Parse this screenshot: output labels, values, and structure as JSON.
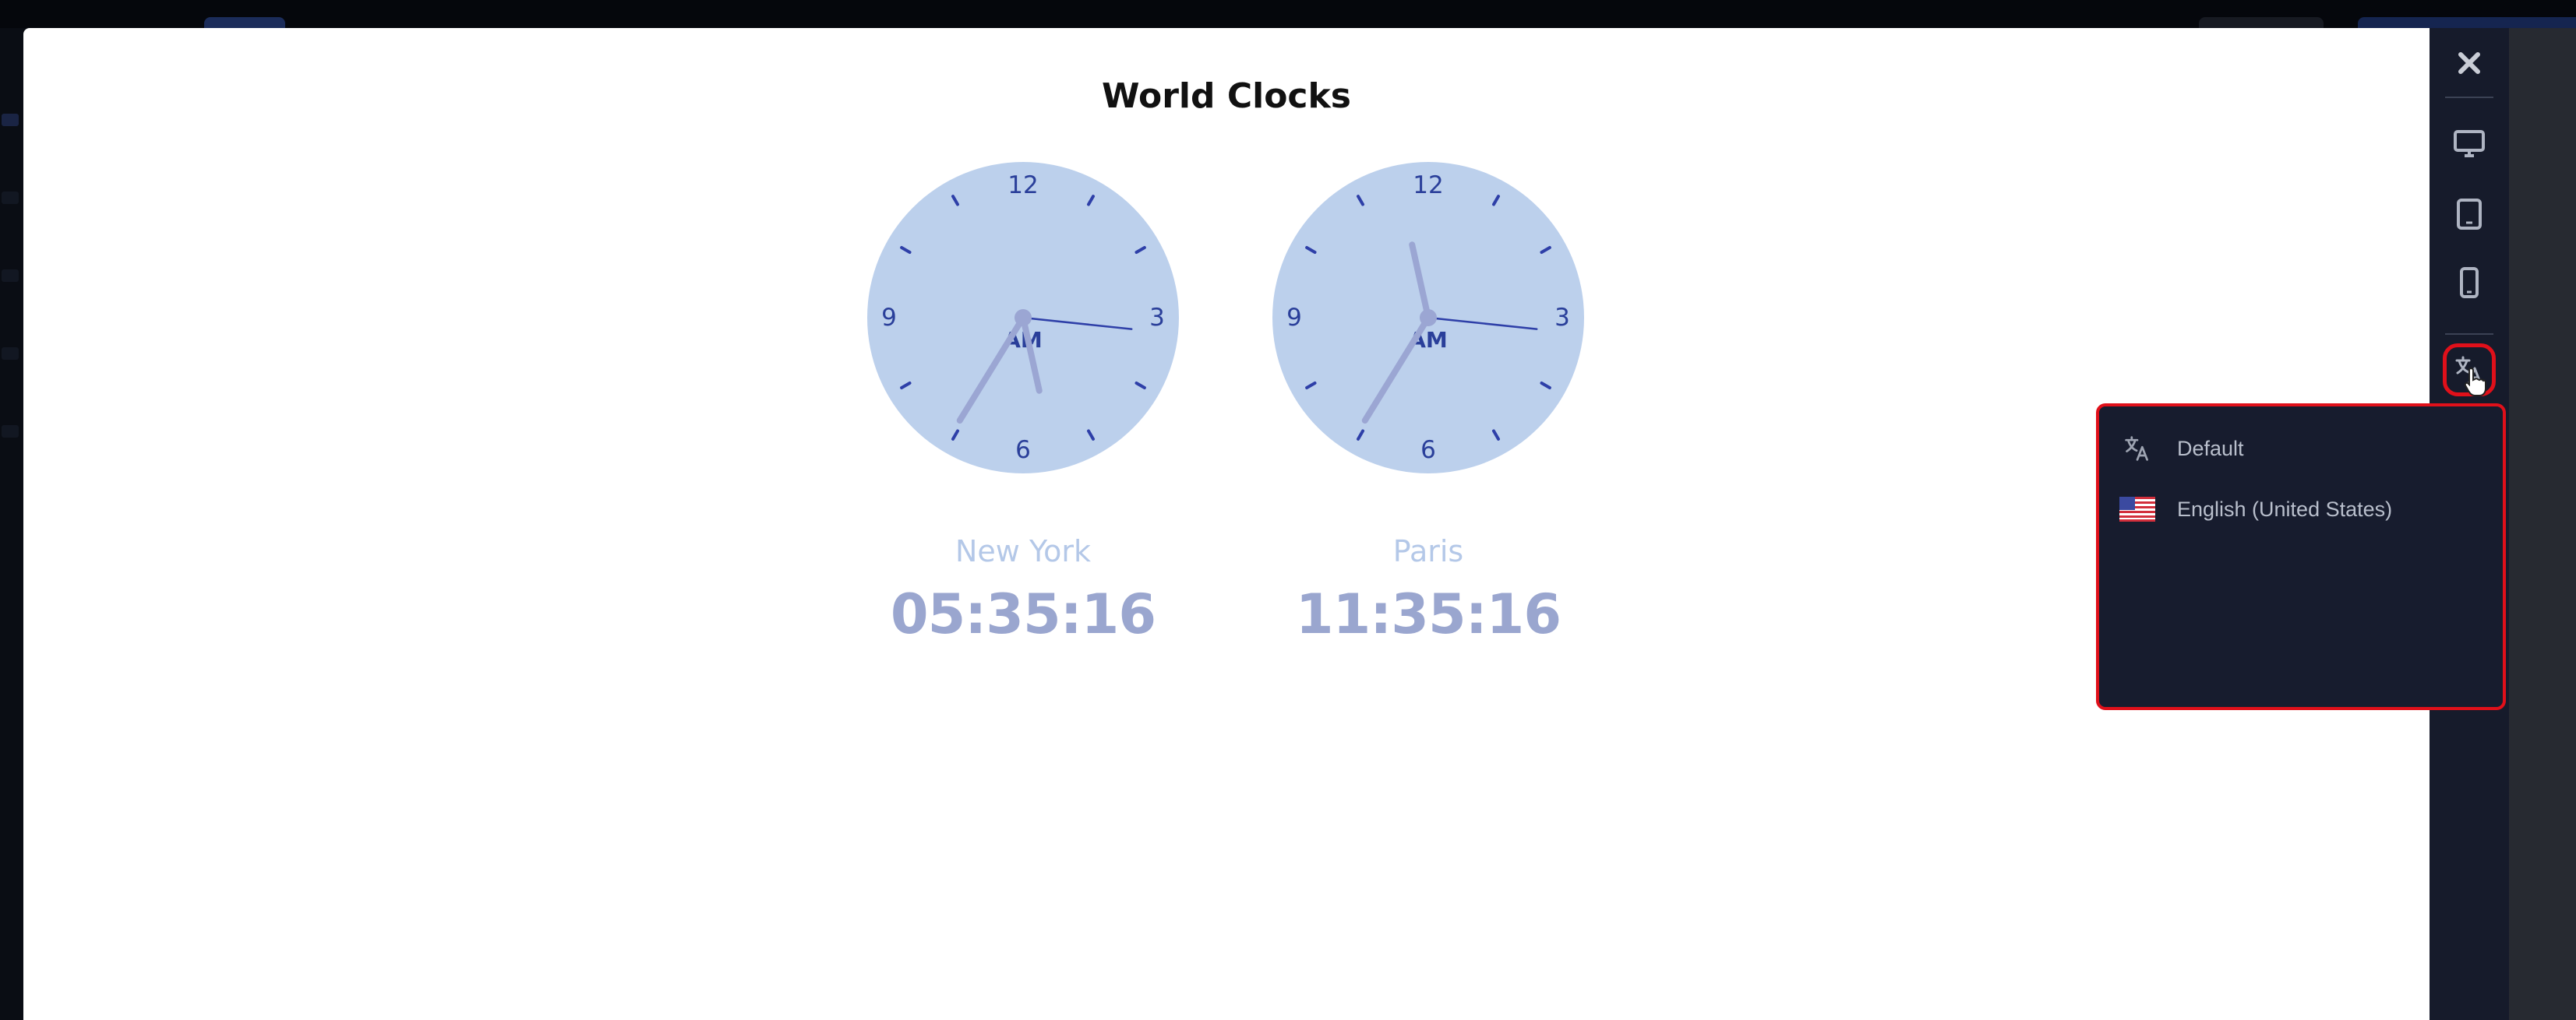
{
  "modal": {
    "title": "World Clocks"
  },
  "clocks": [
    {
      "city": "New York",
      "time": "05:35:16",
      "period": "AM",
      "dial_numbers": [
        "12",
        "3",
        "6",
        "9"
      ],
      "hour": 5,
      "minute": 35,
      "second": 16
    },
    {
      "city": "Paris",
      "time": "11:35:16",
      "period": "AM",
      "dial_numbers": [
        "12",
        "3",
        "6",
        "9"
      ],
      "hour": 11,
      "minute": 35,
      "second": 16
    }
  ],
  "toolbar": {
    "buttons": [
      {
        "name": "close",
        "icon": "close-icon"
      },
      {
        "name": "desktop",
        "icon": "monitor-icon"
      },
      {
        "name": "tablet",
        "icon": "tablet-icon"
      },
      {
        "name": "mobile",
        "icon": "phone-icon"
      },
      {
        "name": "language",
        "icon": "translate-icon",
        "active": true
      }
    ]
  },
  "language_menu": {
    "items": [
      {
        "label": "Default",
        "icon": "translate-icon"
      },
      {
        "label": "English (United States)",
        "icon": "us-flag-icon"
      }
    ]
  },
  "colors": {
    "modal_bg": "#ffffff",
    "toolbar_bg": "#161b2b",
    "dropdown_bg": "#171c2e",
    "highlight": "#e0101a",
    "clock_face": "#bcd0ec",
    "clock_hand": "#9ba6d3",
    "second_hand": "#2e3fa8",
    "city_text": "#b4c8e8",
    "time_text": "#9aa6cf"
  }
}
